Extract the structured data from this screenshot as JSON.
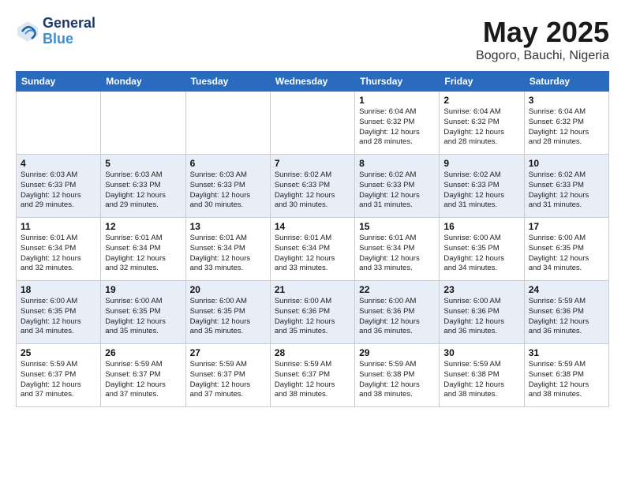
{
  "header": {
    "logo_line1": "General",
    "logo_line2": "Blue",
    "title": "May 2025",
    "subtitle": "Bogoro, Bauchi, Nigeria"
  },
  "weekdays": [
    "Sunday",
    "Monday",
    "Tuesday",
    "Wednesday",
    "Thursday",
    "Friday",
    "Saturday"
  ],
  "weeks": [
    [
      {
        "day": "",
        "info": ""
      },
      {
        "day": "",
        "info": ""
      },
      {
        "day": "",
        "info": ""
      },
      {
        "day": "",
        "info": ""
      },
      {
        "day": "1",
        "info": "Sunrise: 6:04 AM\nSunset: 6:32 PM\nDaylight: 12 hours\nand 28 minutes."
      },
      {
        "day": "2",
        "info": "Sunrise: 6:04 AM\nSunset: 6:32 PM\nDaylight: 12 hours\nand 28 minutes."
      },
      {
        "day": "3",
        "info": "Sunrise: 6:04 AM\nSunset: 6:32 PM\nDaylight: 12 hours\nand 28 minutes."
      }
    ],
    [
      {
        "day": "4",
        "info": "Sunrise: 6:03 AM\nSunset: 6:33 PM\nDaylight: 12 hours\nand 29 minutes."
      },
      {
        "day": "5",
        "info": "Sunrise: 6:03 AM\nSunset: 6:33 PM\nDaylight: 12 hours\nand 29 minutes."
      },
      {
        "day": "6",
        "info": "Sunrise: 6:03 AM\nSunset: 6:33 PM\nDaylight: 12 hours\nand 30 minutes."
      },
      {
        "day": "7",
        "info": "Sunrise: 6:02 AM\nSunset: 6:33 PM\nDaylight: 12 hours\nand 30 minutes."
      },
      {
        "day": "8",
        "info": "Sunrise: 6:02 AM\nSunset: 6:33 PM\nDaylight: 12 hours\nand 31 minutes."
      },
      {
        "day": "9",
        "info": "Sunrise: 6:02 AM\nSunset: 6:33 PM\nDaylight: 12 hours\nand 31 minutes."
      },
      {
        "day": "10",
        "info": "Sunrise: 6:02 AM\nSunset: 6:33 PM\nDaylight: 12 hours\nand 31 minutes."
      }
    ],
    [
      {
        "day": "11",
        "info": "Sunrise: 6:01 AM\nSunset: 6:34 PM\nDaylight: 12 hours\nand 32 minutes."
      },
      {
        "day": "12",
        "info": "Sunrise: 6:01 AM\nSunset: 6:34 PM\nDaylight: 12 hours\nand 32 minutes."
      },
      {
        "day": "13",
        "info": "Sunrise: 6:01 AM\nSunset: 6:34 PM\nDaylight: 12 hours\nand 33 minutes."
      },
      {
        "day": "14",
        "info": "Sunrise: 6:01 AM\nSunset: 6:34 PM\nDaylight: 12 hours\nand 33 minutes."
      },
      {
        "day": "15",
        "info": "Sunrise: 6:01 AM\nSunset: 6:34 PM\nDaylight: 12 hours\nand 33 minutes."
      },
      {
        "day": "16",
        "info": "Sunrise: 6:00 AM\nSunset: 6:35 PM\nDaylight: 12 hours\nand 34 minutes."
      },
      {
        "day": "17",
        "info": "Sunrise: 6:00 AM\nSunset: 6:35 PM\nDaylight: 12 hours\nand 34 minutes."
      }
    ],
    [
      {
        "day": "18",
        "info": "Sunrise: 6:00 AM\nSunset: 6:35 PM\nDaylight: 12 hours\nand 34 minutes."
      },
      {
        "day": "19",
        "info": "Sunrise: 6:00 AM\nSunset: 6:35 PM\nDaylight: 12 hours\nand 35 minutes."
      },
      {
        "day": "20",
        "info": "Sunrise: 6:00 AM\nSunset: 6:35 PM\nDaylight: 12 hours\nand 35 minutes."
      },
      {
        "day": "21",
        "info": "Sunrise: 6:00 AM\nSunset: 6:36 PM\nDaylight: 12 hours\nand 35 minutes."
      },
      {
        "day": "22",
        "info": "Sunrise: 6:00 AM\nSunset: 6:36 PM\nDaylight: 12 hours\nand 36 minutes."
      },
      {
        "day": "23",
        "info": "Sunrise: 6:00 AM\nSunset: 6:36 PM\nDaylight: 12 hours\nand 36 minutes."
      },
      {
        "day": "24",
        "info": "Sunrise: 5:59 AM\nSunset: 6:36 PM\nDaylight: 12 hours\nand 36 minutes."
      }
    ],
    [
      {
        "day": "25",
        "info": "Sunrise: 5:59 AM\nSunset: 6:37 PM\nDaylight: 12 hours\nand 37 minutes."
      },
      {
        "day": "26",
        "info": "Sunrise: 5:59 AM\nSunset: 6:37 PM\nDaylight: 12 hours\nand 37 minutes."
      },
      {
        "day": "27",
        "info": "Sunrise: 5:59 AM\nSunset: 6:37 PM\nDaylight: 12 hours\nand 37 minutes."
      },
      {
        "day": "28",
        "info": "Sunrise: 5:59 AM\nSunset: 6:37 PM\nDaylight: 12 hours\nand 38 minutes."
      },
      {
        "day": "29",
        "info": "Sunrise: 5:59 AM\nSunset: 6:38 PM\nDaylight: 12 hours\nand 38 minutes."
      },
      {
        "day": "30",
        "info": "Sunrise: 5:59 AM\nSunset: 6:38 PM\nDaylight: 12 hours\nand 38 minutes."
      },
      {
        "day": "31",
        "info": "Sunrise: 5:59 AM\nSunset: 6:38 PM\nDaylight: 12 hours\nand 38 minutes."
      }
    ]
  ]
}
